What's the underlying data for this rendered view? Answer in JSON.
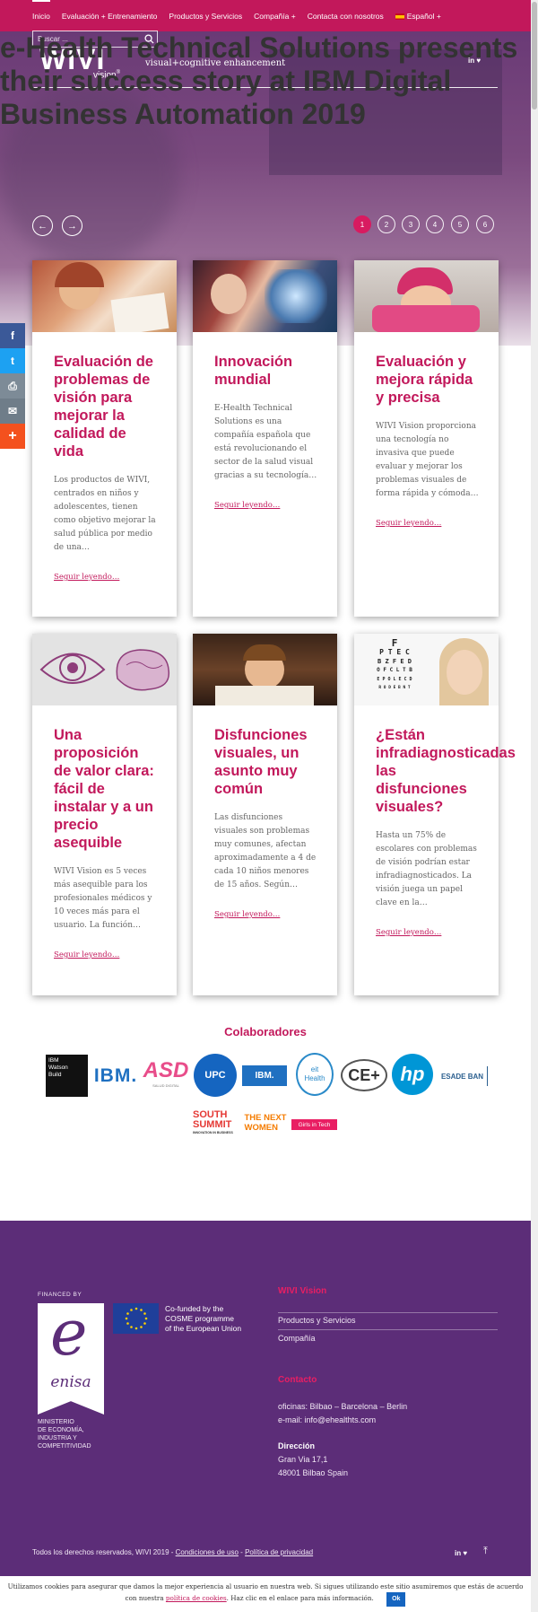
{
  "nav": {
    "items": [
      {
        "label": "Inicio"
      },
      {
        "label": "Evaluación + Entrenamiento"
      },
      {
        "label": "Productos y Servicios"
      },
      {
        "label": "Compañía"
      },
      {
        "label": "Contacta con nosotros"
      },
      {
        "label": "Español"
      }
    ],
    "plus": "+",
    "search_placeholder": "Buscar ..."
  },
  "hero": {
    "logo": "WIVI",
    "logo_sub": "vision",
    "reg": "®",
    "tagline": "visual+cognitive enhancement",
    "social": "in  ♥",
    "title": "e-Health Technical Solutions presents their success story at IBM Digital Business Automation 2019",
    "prev": "←",
    "next": "→",
    "pages": [
      "1",
      "2",
      "3",
      "4",
      "5",
      "6"
    ],
    "active_page": 1
  },
  "share": {
    "icons": [
      "facebook-icon",
      "twitter-icon",
      "print-icon",
      "email-icon",
      "plus-icon"
    ],
    "glyphs": [
      "f",
      "t",
      "⎙",
      "✉",
      "+"
    ],
    "colors": [
      "#3b5998",
      "#1da1f2",
      "#7d8b97",
      "#6f7d89",
      "#f4511e"
    ]
  },
  "cards": [
    {
      "title": "Evaluación de problemas de visión para mejorar la calidad de vida",
      "excerpt": "Los productos de WIVI, centrados en niños y adolescentes, tienen como objetivo mejorar la salud pública por medio de una…",
      "more": "Seguir leyendo…"
    },
    {
      "title": "Innovación mundial",
      "excerpt": "E-Health Technical Solutions es una compañía española que está revolucionando el sector de la salud visual gracias a su tecnología…",
      "more": "Seguir leyendo…"
    },
    {
      "title": "Evaluación y mejora rápida y precisa",
      "excerpt": "WIVI Vision proporciona una tecnología no invasiva que puede evaluar y mejorar los problemas visuales de forma rápida y cómoda…",
      "more": "Seguir leyendo…"
    },
    {
      "title": "Una proposición de valor clara: fácil de instalar y a un precio asequible",
      "excerpt": "WIVI Vision es 5 veces más asequible para los profesionales médicos y 10 veces más para el usuario. La función…",
      "more": "Seguir leyendo…"
    },
    {
      "title": "Disfunciones visuales, un asunto muy común",
      "excerpt": "Las disfunciones visuales son problemas muy comunes, afectan aproximadamente a 4 de cada 10 niños menores de 15 años. Según…",
      "more": "Seguir leyendo…"
    },
    {
      "title": "¿Están infradiagnosticadas las disfunciones visuales?",
      "excerpt": "Hasta un 75% de escolares con problemas de visión podrían estar infradiagnosticados. La visión juega un papel clave en la…",
      "more": "Seguir leyendo…"
    }
  ],
  "eye_chart": {
    "lines": [
      "F",
      "P T E C",
      "B Z F E D",
      "O F C L T B",
      "E P O L E C D",
      "R O D E B N T"
    ]
  },
  "collab": {
    "title": "Colaboradores",
    "logos": [
      {
        "name": "ibm-watson-logo",
        "text": "IBM\nWatson\nBuild"
      },
      {
        "name": "ibm-logo",
        "text": "IBM."
      },
      {
        "name": "asd-logo",
        "text": "ASD"
      },
      {
        "name": "upc-logo",
        "text": "UPC"
      },
      {
        "name": "ibm-partner-logo",
        "text": "IBM."
      },
      {
        "name": "eit-health-logo",
        "text": "eit\nHealth"
      },
      {
        "name": "ce-plus-logo",
        "text": "CE+"
      },
      {
        "name": "hp-logo",
        "text": "hp"
      },
      {
        "name": "esade-logo",
        "text": "ESADE BAN"
      },
      {
        "name": "south-summit-logo",
        "text": "SOUTH\nSUMMIT"
      },
      {
        "name": "the-next-women-logo",
        "text": "THE NEXT\nWOMEN"
      },
      {
        "name": "girls-in-tech-logo",
        "text": "Girls in Tech"
      }
    ],
    "asd_sub": "SALUD DIGITAL",
    "summit_sub": "INNOVATION IN BUSINESS"
  },
  "footer": {
    "financed_by": "FINANCED BY",
    "enisa_letter": "e",
    "enisa": "enisa",
    "ministry": "MINISTERIO\nDE ECONOMÍA,\nINDUSTRIA Y\nCOMPETITIVIDAD",
    "cosme": "Co-funded by the\nCOSME programme\nof the European Union",
    "wivi_head": "WIVI Vision",
    "links": [
      "Productos y Servicios",
      "Compañía"
    ],
    "contact_head": "Contacto",
    "offices": "oficinas: Bilbao – Barcelona – Berlin",
    "email": "e-mail: info@ehealthts.com",
    "address_head": "Dirección",
    "address1": "Gran Via 17,1",
    "address2": "48001 Bilbao Spain",
    "copyright": "Todos los derechos reservados, WIVI 2019 -",
    "terms": "Condiciones de uso",
    "separator": "-",
    "privacy": "Política de privacidad",
    "social": "in  ♥",
    "top_icon": "⤒"
  },
  "cookie": {
    "text1": "Utilizamos cookies para asegurar que damos la mejor experiencia al usuario en nuestra web. Si sigues utilizando este sitio asumiremos que estás de acuerdo",
    "text2": "con nuestra",
    "link": "política de cookies",
    "text3": ". Haz clic en el enlace para más información.",
    "ok": "Ok"
  }
}
